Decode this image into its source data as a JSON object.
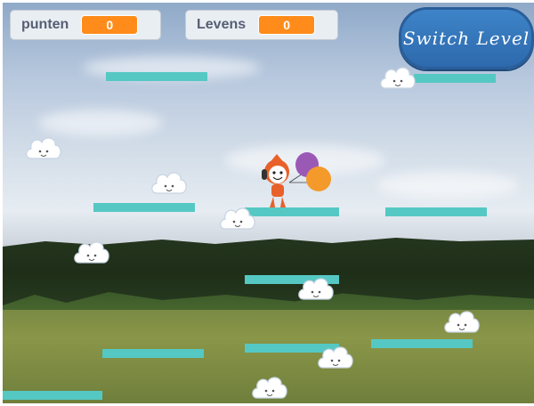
{
  "hud": {
    "score_label": "punten",
    "score_value": "0",
    "lives_label": "Levens",
    "lives_value": "0"
  },
  "switch_button_label": "Switch Level",
  "colors": {
    "platform": "#55c8c4",
    "monitor_value": "#ff8c1a",
    "button": "#3e84c8"
  }
}
